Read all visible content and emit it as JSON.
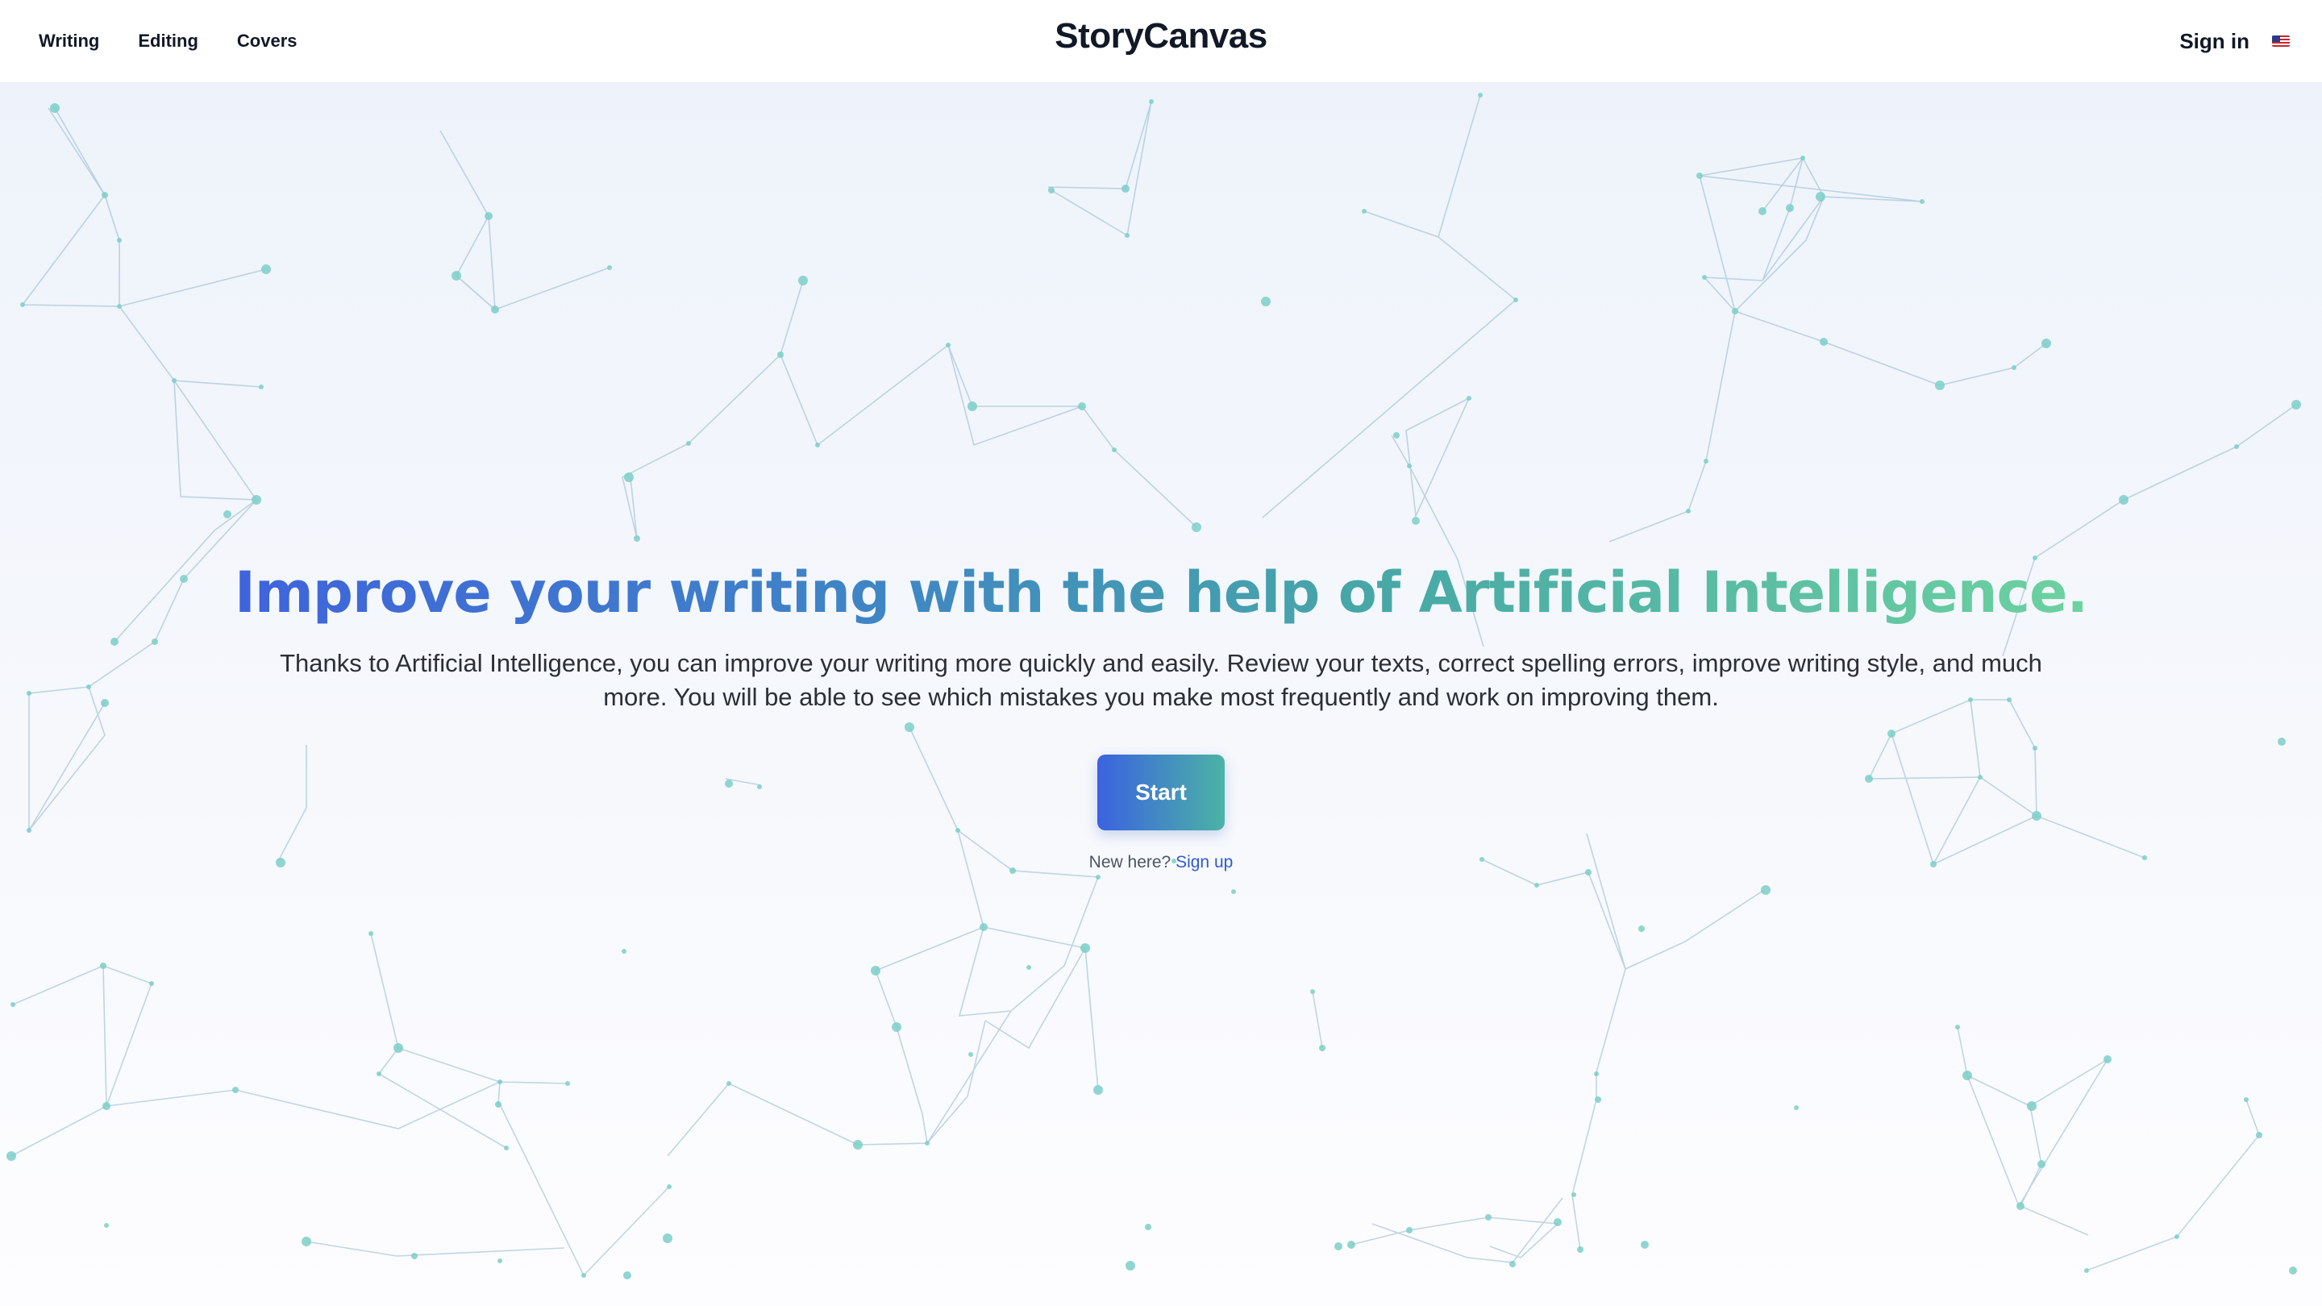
{
  "nav": {
    "links": [
      "Writing",
      "Editing",
      "Covers"
    ],
    "brand": "StoryCanvas",
    "signin": "Sign in",
    "language_icon": "us-flag-icon"
  },
  "hero": {
    "headline": "Improve your writing with the help of Artificial Intelligence.",
    "subtext": "Thanks to Artificial Intelligence, you can improve your writing more quickly and easily. Review your texts, correct spelling errors, improve writing style, and much more. You will be able to see which mistakes you make most frequently and work on improving them.",
    "cta_label": "Start",
    "signup_prompt": "New here?",
    "signup_link": "Sign up"
  },
  "colors": {
    "headline_gradient_start": "#3f63dc",
    "headline_gradient_end": "#6dd2a0",
    "button_gradient_start": "#3b62e0",
    "button_gradient_end": "#4bb3a5",
    "link": "#2f5ad8",
    "network_node": "#7ccfc8",
    "network_line": "#8fb6cf"
  }
}
